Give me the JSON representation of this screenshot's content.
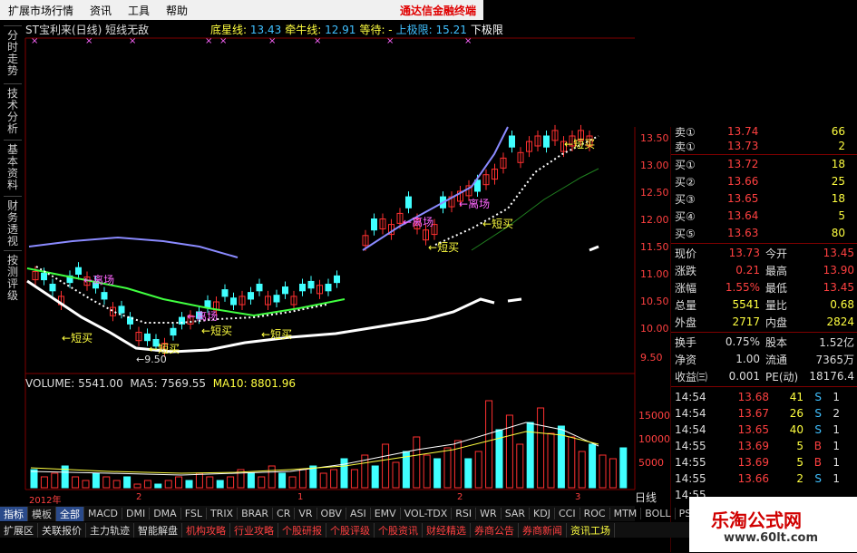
{
  "menu": {
    "items": [
      "扩展市场行情",
      "资讯",
      "工具",
      "帮助"
    ],
    "brand": "通达信金融终端"
  },
  "sidebar": {
    "tabs": [
      "分时走势",
      "技术分析",
      "基本资料",
      "财务透视",
      "按测评级"
    ]
  },
  "chart": {
    "title": "ST宝利来(日线) 短线无敌",
    "indicators": [
      {
        "label": "底星线: ",
        "value": "13.43",
        "color": "#40c0ff"
      },
      {
        "label": "牵牛线: ",
        "value": "12.91",
        "color": "#40c0ff"
      },
      {
        "label": "等待: ",
        "value": "-",
        "color": "#ffff40"
      },
      {
        "label": "上极限: ",
        "value": "15.21",
        "color": "#40c0ff"
      },
      {
        "label": "下极限",
        "value": "",
        "color": "#ffffff"
      }
    ],
    "low_mark": "9.50",
    "annotations": [
      "离场",
      "离场",
      "离场",
      "离场",
      "短买",
      "短买",
      "短买",
      "短买",
      "短买",
      "短买",
      "短买"
    ],
    "price_axis": [
      "13.50",
      "13.00",
      "12.50",
      "12.00",
      "11.50",
      "11.00",
      "10.50",
      "10.00",
      "9.50"
    ]
  },
  "volume": {
    "label": "VOLUME: 5541.00",
    "ma5": "MA5: 7569.55",
    "ma10": "MA10: 8801.96",
    "axis": [
      "15000",
      "10000",
      "5000"
    ]
  },
  "date_axis": [
    "2012年",
    "2",
    "1",
    "2",
    "3"
  ],
  "quote": {
    "asks": [
      {
        "label": "卖①",
        "price": "13.74",
        "vol": "66"
      },
      {
        "label": "卖①",
        "price": "13.73",
        "vol": "2"
      }
    ],
    "bids": [
      {
        "label": "买①",
        "price": "13.72",
        "vol": "18"
      },
      {
        "label": "买②",
        "price": "13.66",
        "vol": "25"
      },
      {
        "label": "买③",
        "price": "13.65",
        "vol": "18"
      },
      {
        "label": "买④",
        "price": "13.64",
        "vol": "5"
      },
      {
        "label": "买⑤",
        "price": "13.63",
        "vol": "80"
      }
    ],
    "stats": [
      {
        "k1": "现价",
        "v1": "13.73",
        "k2": "今开",
        "v2": "13.45"
      },
      {
        "k1": "涨跌",
        "v1": "0.21",
        "k2": "最高",
        "v2": "13.90"
      },
      {
        "k1": "涨幅",
        "v1": "1.55%",
        "k2": "最低",
        "v2": "13.45"
      },
      {
        "k1": "总量",
        "v1": "5541",
        "k2": "量比",
        "v2": "0.68"
      },
      {
        "k1": "外盘",
        "v1": "2717",
        "k2": "内盘",
        "v2": "2824"
      },
      {
        "k1": "换手",
        "v1": "0.75%",
        "k2": "股本",
        "v2": "1.52亿"
      },
      {
        "k1": "净资",
        "v1": "1.00",
        "k2": "流通",
        "v2": "7365万"
      },
      {
        "k1": "收益㈢",
        "v1": "0.001",
        "k2": "PE(动)",
        "v2": "18176.4"
      }
    ],
    "ticks": [
      {
        "t": "14:54",
        "p": "13.68",
        "v": "41",
        "d": "S",
        "x": "1"
      },
      {
        "t": "14:54",
        "p": "13.67",
        "v": "26",
        "d": "S",
        "x": "2"
      },
      {
        "t": "14:54",
        "p": "13.65",
        "v": "40",
        "d": "S",
        "x": "1"
      },
      {
        "t": "14:55",
        "p": "13.69",
        "v": "5",
        "d": "B",
        "x": "1"
      },
      {
        "t": "14:55",
        "p": "13.69",
        "v": "5",
        "d": "B",
        "x": "1"
      },
      {
        "t": "14:55",
        "p": "13.66",
        "v": "2",
        "d": "S",
        "x": "1"
      }
    ],
    "tick_partial": "14:55"
  },
  "tabs_indicators": [
    "指标",
    "模板",
    "全部",
    "MACD",
    "DMI",
    "DMA",
    "FSL",
    "TRIX",
    "BRAR",
    "CR",
    "VR",
    "OBV",
    "ASI",
    "EMV",
    "VOL-TDX",
    "RSI",
    "WR",
    "SAR",
    "KDJ",
    "CCI",
    "ROC",
    "MTM",
    "BOLL",
    "PSY"
  ],
  "day_line_label": "日线",
  "tabs_bottom": [
    "扩展区",
    "关联报价",
    "主力轨迹",
    "智能解盘",
    "机构攻略",
    "行业攻略",
    "个股研报",
    "个股评级",
    "个股资讯",
    "财经精选",
    "券商公告",
    "券商新闻",
    "资讯工场"
  ],
  "tabs_bottom_red": [
    4,
    5,
    6,
    7,
    8,
    9,
    10,
    11
  ],
  "watermark": {
    "title": "乐淘公式网",
    "url": "www.60lt.com"
  },
  "colors": {
    "up": "#ff3030",
    "down": "#40ffff",
    "text": "#c8c8c8",
    "price": "#ff4040",
    "volume": "#ffff40"
  }
}
